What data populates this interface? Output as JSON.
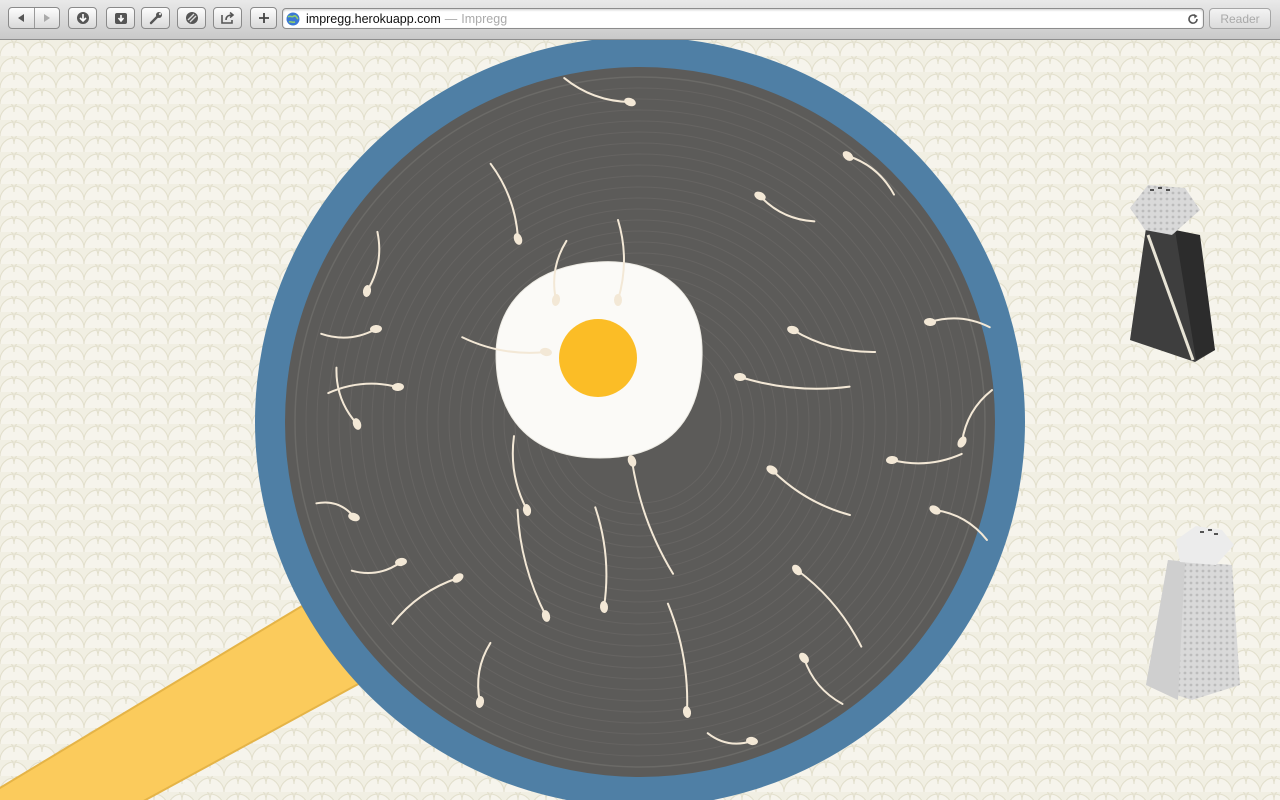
{
  "browser": {
    "url_host": "impregg.herokuapp.com",
    "title_separator": "—",
    "page_title": "Impregg",
    "reader_label": "Reader"
  },
  "toolbar_icons": [
    "back-arrow-icon",
    "forward-arrow-icon",
    "downloads-icon",
    "download-icon",
    "wrench-icon",
    "bookmarks-icon",
    "share-icon",
    "new-tab-plus-icon",
    "globe-icon",
    "reload-icon"
  ],
  "scene": {
    "background": "#f1efe3",
    "pattern_color": "#e4e1cf",
    "pan_rim_color": "#4f7fa5",
    "pan_surface_color": "#5c5b59",
    "pan_groove_color": "#666462",
    "handle_color": "#fbcb5c",
    "egg_white_color": "#fbfaf7",
    "yolk_color": "#fbbd26",
    "sperm_color": "#f3e8d6",
    "pepper_shaker_color": "#3c3c3c",
    "salt_shaker_color": "#dedede",
    "sperm_count": 30
  }
}
